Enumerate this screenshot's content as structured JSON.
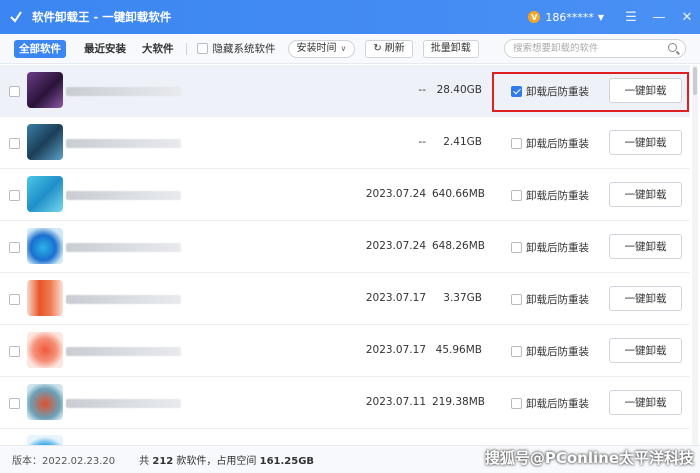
{
  "titlebar": {
    "title": "软件卸载王 - 一键卸载软件",
    "user": "186*****",
    "vip_glyph": "V"
  },
  "toolbar": {
    "tabs": [
      "全部软件",
      "最近安装",
      "大软件"
    ],
    "hide_system": "隐藏系统软件",
    "sort_select": "安装时间",
    "refresh_label": "刷新",
    "batch_label": "批量卸载",
    "search_placeholder": "搜索想要卸载的软件"
  },
  "colors": {
    "accent": "#3b86f2",
    "highlight_box": "#e02020"
  },
  "rows": [
    {
      "date": "--",
      "size": "28.40GB",
      "option": "卸载后防重装",
      "checked": true,
      "button": "一键卸载"
    },
    {
      "date": "--",
      "size": "2.41GB",
      "option": "卸载后防重装",
      "checked": false,
      "button": "一键卸载"
    },
    {
      "date": "2023.07.24",
      "size": "640.66MB",
      "option": "卸载后防重装",
      "checked": false,
      "button": "一键卸载"
    },
    {
      "date": "2023.07.24",
      "size": "648.26MB",
      "option": "卸载后防重装",
      "checked": false,
      "button": "一键卸载"
    },
    {
      "date": "2023.07.17",
      "size": "3.37GB",
      "option": "卸载后防重装",
      "checked": false,
      "button": "一键卸载"
    },
    {
      "date": "2023.07.17",
      "size": "45.96MB",
      "option": "卸载后防重装",
      "checked": false,
      "button": "一键卸载"
    },
    {
      "date": "2023.07.11",
      "size": "219.38MB",
      "option": "卸载后防重装",
      "checked": false,
      "button": "一键卸载"
    }
  ],
  "status": {
    "version": "版本：2022.02.23.20",
    "summary_prefix": "共",
    "count": "212",
    "summary_mid": "款软件，占用空间",
    "space": "161.25GB"
  },
  "watermark": "搜狐号@PConline太平洋科技"
}
